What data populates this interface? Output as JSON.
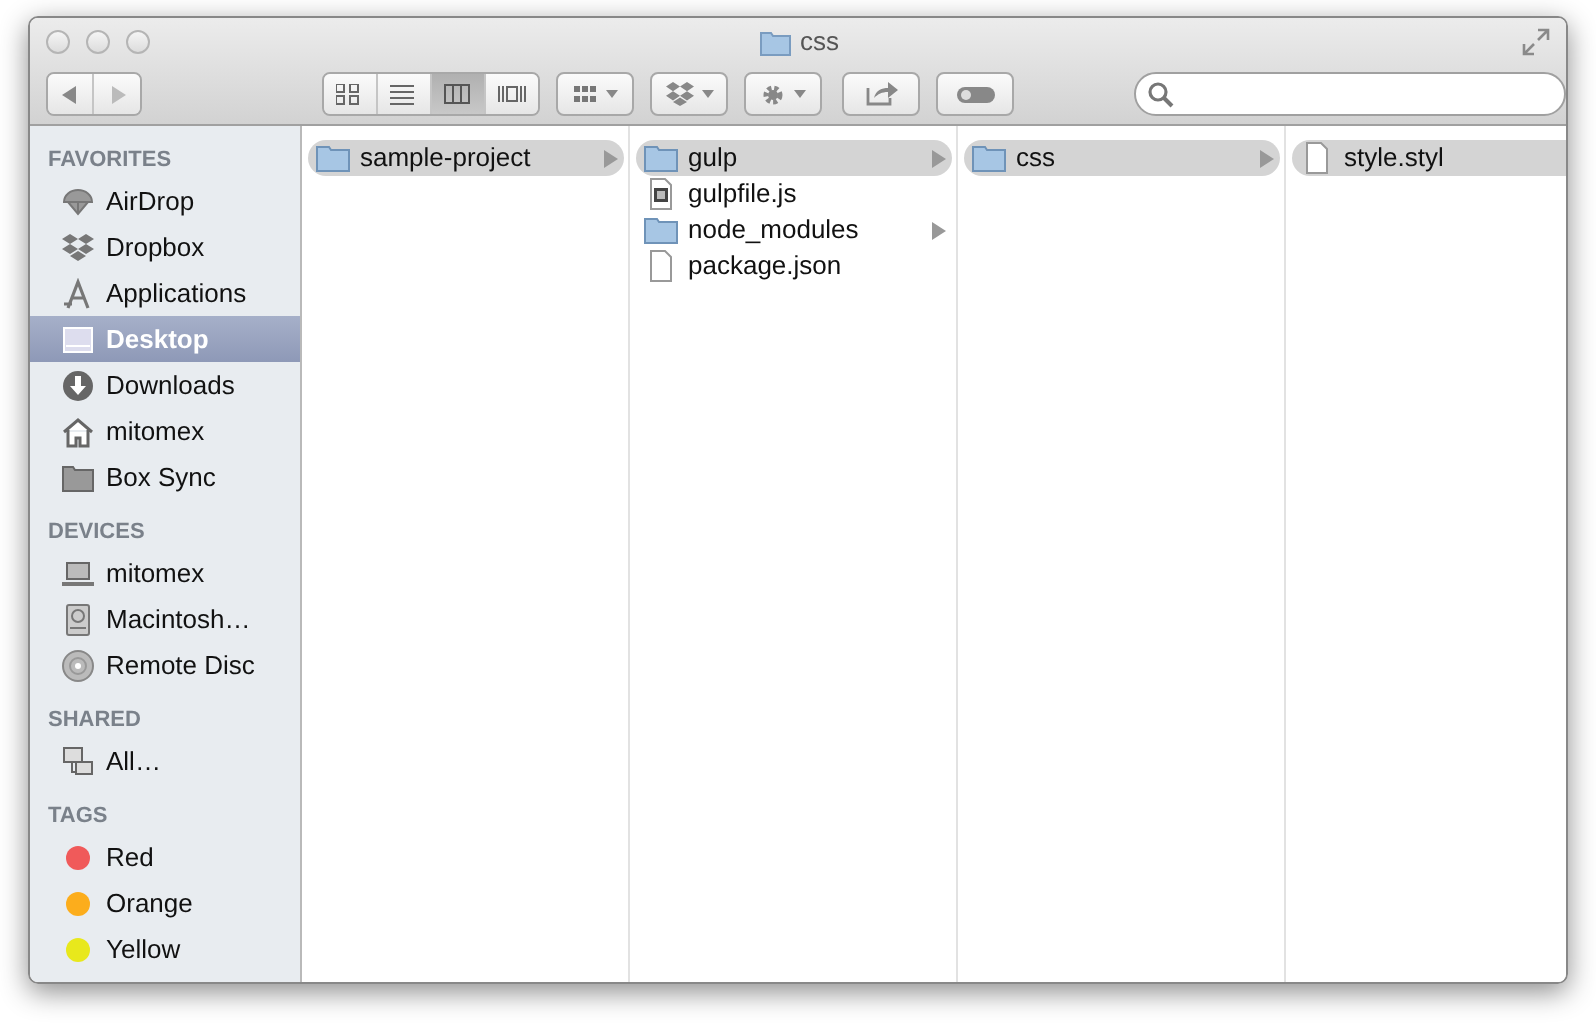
{
  "window": {
    "title": "css"
  },
  "toolbar": {
    "view_buttons": [
      {
        "kind": "icons",
        "selected": false
      },
      {
        "kind": "list",
        "selected": false
      },
      {
        "kind": "columns",
        "selected": true
      },
      {
        "kind": "coverflow",
        "selected": false
      }
    ]
  },
  "sidebar": {
    "sections": [
      {
        "title": "FAVORITES",
        "items": [
          {
            "label": "AirDrop",
            "kind": "airdrop",
            "selected": false
          },
          {
            "label": "Dropbox",
            "kind": "dropbox",
            "selected": false
          },
          {
            "label": "Applications",
            "kind": "apps",
            "selected": false
          },
          {
            "label": "Desktop",
            "kind": "desktop",
            "selected": true
          },
          {
            "label": "Downloads",
            "kind": "downloads",
            "selected": false
          },
          {
            "label": "mitomex",
            "kind": "home",
            "selected": false
          },
          {
            "label": "Box Sync",
            "kind": "folder",
            "selected": false
          }
        ]
      },
      {
        "title": "DEVICES",
        "items": [
          {
            "label": "mitomex",
            "kind": "laptop",
            "selected": false
          },
          {
            "label": "Macintosh…",
            "kind": "disk",
            "selected": false
          },
          {
            "label": "Remote Disc",
            "kind": "disc",
            "selected": false
          }
        ]
      },
      {
        "title": "SHARED",
        "items": [
          {
            "label": "All…",
            "kind": "network",
            "selected": false
          }
        ]
      },
      {
        "title": "TAGS",
        "items": [
          {
            "label": "Red",
            "kind": "tag",
            "color": "#f05a5a",
            "selected": false
          },
          {
            "label": "Orange",
            "kind": "tag",
            "color": "#fcad1c",
            "selected": false
          },
          {
            "label": "Yellow",
            "kind": "tag",
            "color": "#e8e81c",
            "selected": false
          }
        ]
      }
    ]
  },
  "columns": [
    {
      "items": [
        {
          "name": "sample-project",
          "kind": "folder",
          "selected": true,
          "has_children": true
        }
      ]
    },
    {
      "items": [
        {
          "name": "gulp",
          "kind": "folder",
          "selected": true,
          "has_children": true
        },
        {
          "name": "gulpfile.js",
          "kind": "script",
          "selected": false,
          "has_children": false
        },
        {
          "name": "node_modules",
          "kind": "folder",
          "selected": false,
          "has_children": true
        },
        {
          "name": "package.json",
          "kind": "file",
          "selected": false,
          "has_children": false
        }
      ]
    },
    {
      "items": [
        {
          "name": "css",
          "kind": "folder",
          "selected": true,
          "has_children": true
        }
      ]
    },
    {
      "items": [
        {
          "name": "style.styl",
          "kind": "file",
          "selected": true
        }
      ]
    }
  ]
}
